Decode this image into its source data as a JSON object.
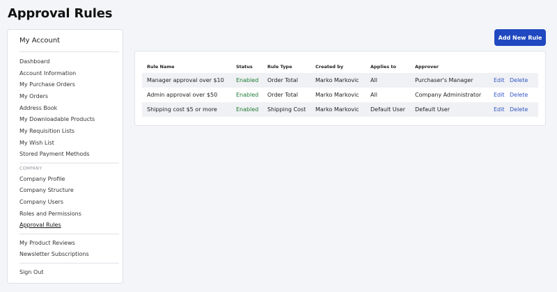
{
  "page": {
    "title": "Approval Rules"
  },
  "sidebar": {
    "heading": "My Account",
    "account_items": [
      {
        "label": "Dashboard"
      },
      {
        "label": "Account Information"
      },
      {
        "label": "My Purchase Orders"
      },
      {
        "label": "My Orders"
      },
      {
        "label": "Address Book"
      },
      {
        "label": "My Downloadable Products"
      },
      {
        "label": "My Requisition Lists"
      },
      {
        "label": "My Wish List"
      },
      {
        "label": "Stored Payment Methods"
      }
    ],
    "company_heading": "COMPANY",
    "company_items": [
      {
        "label": "Company Profile"
      },
      {
        "label": "Company Structure"
      },
      {
        "label": "Company Users"
      },
      {
        "label": "Roles and Permissions"
      },
      {
        "label": "Approval Rules",
        "active": true
      }
    ],
    "review_items": [
      {
        "label": "My Product Reviews"
      },
      {
        "label": "Newsletter Subscriptions"
      }
    ],
    "sign_out": "Sign Out"
  },
  "toolbar": {
    "add_label": "Add New Rule"
  },
  "table": {
    "headers": [
      "Rule Name",
      "Status",
      "Rule Type",
      "Created by",
      "Applies to",
      "Approver"
    ],
    "rows": [
      {
        "name": "Manager approval over $10",
        "status": "Enabled",
        "type": "Order Total",
        "created_by": "Marko Markovic",
        "applies_to": "All",
        "approver": "Purchaser's Manager",
        "edit": "Edit",
        "delete": "Delete"
      },
      {
        "name": "Admin approval over $50",
        "status": "Enabled",
        "type": "Order Total",
        "created_by": "Marko Markovic",
        "applies_to": "All",
        "approver": "Company Administrator",
        "edit": "Edit",
        "delete": "Delete"
      },
      {
        "name": "Shipping cost $5 or more",
        "status": "Enabled",
        "type": "Shipping Cost",
        "created_by": "Marko Markovic",
        "applies_to": "Default User",
        "approver": "Default User",
        "edit": "Edit",
        "delete": "Delete"
      }
    ]
  },
  "colors": {
    "accent": "#1f48c1",
    "enabled": "#1e7b34",
    "link": "#2f55c5"
  }
}
